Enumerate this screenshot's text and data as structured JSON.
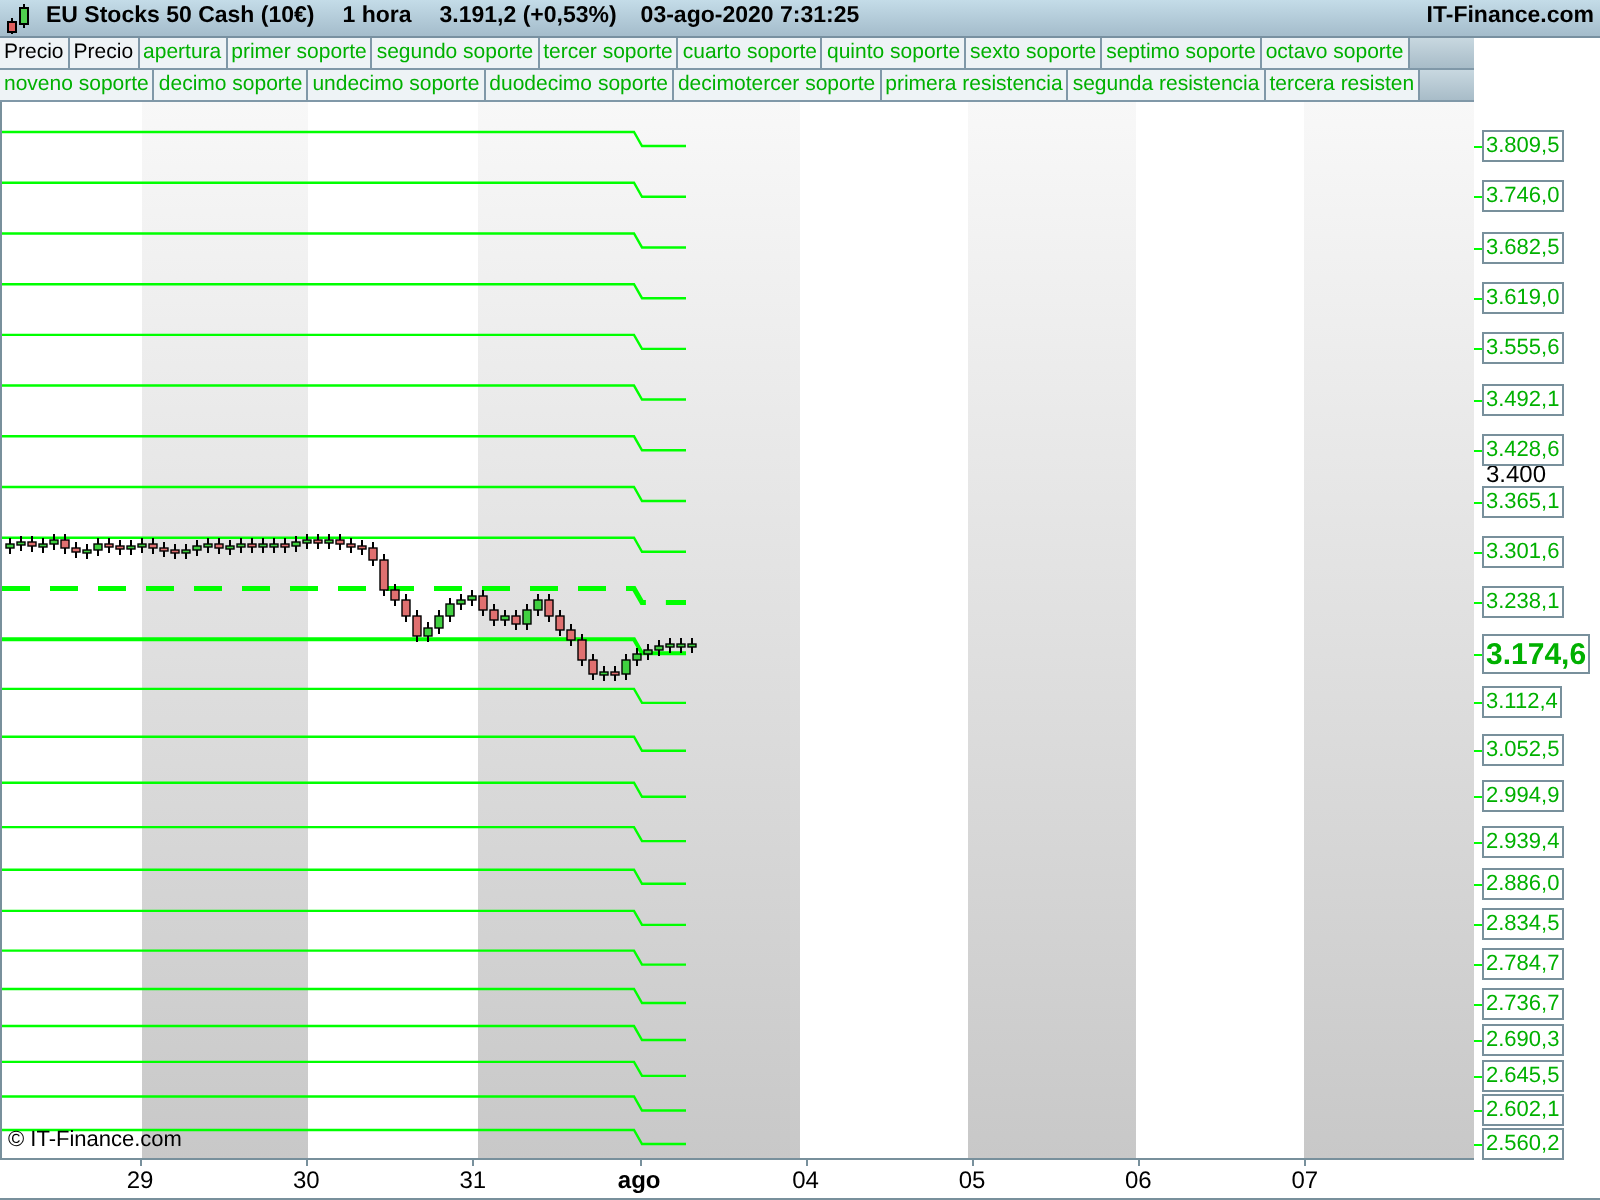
{
  "header": {
    "instrument": "EU Stocks 50 Cash (10€)",
    "timeframe": "1 hora",
    "quote": "3.191,2 (+0,53%)",
    "datetime": "03-ago-2020 7:31:25",
    "brand": "IT-Finance.com"
  },
  "legend_rows": [
    [
      {
        "label": "Precio",
        "color": "#000000"
      },
      {
        "label": "Precio",
        "color": "#000000"
      },
      {
        "label": "apertura",
        "color": "#00b000"
      },
      {
        "label": "primer soporte",
        "color": "#00b000"
      },
      {
        "label": "segundo soporte",
        "color": "#00b000"
      },
      {
        "label": "tercer soporte",
        "color": "#00b000"
      },
      {
        "label": "cuarto soporte",
        "color": "#00b000"
      },
      {
        "label": "quinto soporte",
        "color": "#00b000"
      },
      {
        "label": "sexto soporte",
        "color": "#00b000"
      },
      {
        "label": "septimo soporte",
        "color": "#00b000"
      },
      {
        "label": "octavo soporte",
        "color": "#00b000"
      }
    ],
    [
      {
        "label": "noveno soporte",
        "color": "#00b000"
      },
      {
        "label": "decimo soporte",
        "color": "#00b000"
      },
      {
        "label": "undecimo soporte",
        "color": "#00b000"
      },
      {
        "label": "duodecimo soporte",
        "color": "#00b000"
      },
      {
        "label": "decimotercer soporte",
        "color": "#00b000"
      },
      {
        "label": "primera resistencia",
        "color": "#00b000"
      },
      {
        "label": "segunda resistencia",
        "color": "#00b000"
      },
      {
        "label": "tercera resisten",
        "color": "#00b000"
      }
    ]
  ],
  "price_levels": [
    {
      "label": "3.809,5",
      "kind": "level",
      "dashed": false
    },
    {
      "label": "3.746,0",
      "kind": "level",
      "dashed": false
    },
    {
      "label": "3.682,5",
      "kind": "level",
      "dashed": false
    },
    {
      "label": "3.619,0",
      "kind": "level",
      "dashed": false
    },
    {
      "label": "3.555,6",
      "kind": "level",
      "dashed": false
    },
    {
      "label": "3.492,1",
      "kind": "level",
      "dashed": false
    },
    {
      "label": "3.428,6",
      "kind": "level",
      "dashed": false
    },
    {
      "label": "3.365,1",
      "kind": "level",
      "dashed": false
    },
    {
      "label": "3.301,6",
      "kind": "level",
      "dashed": false
    },
    {
      "label": "3.238,1",
      "kind": "level",
      "dashed": true
    },
    {
      "label": "3.174,6",
      "kind": "current",
      "dashed": false
    },
    {
      "label": "3.112,4",
      "kind": "level",
      "dashed": false
    },
    {
      "label": "3.052,5",
      "kind": "level",
      "dashed": false
    },
    {
      "label": "2.994,9",
      "kind": "level",
      "dashed": false
    },
    {
      "label": "2.939,4",
      "kind": "level",
      "dashed": false
    },
    {
      "label": "2.886,0",
      "kind": "level",
      "dashed": false
    },
    {
      "label": "2.834,5",
      "kind": "level",
      "dashed": false
    },
    {
      "label": "2.784,7",
      "kind": "level",
      "dashed": false
    },
    {
      "label": "2.736,7",
      "kind": "level",
      "dashed": false
    },
    {
      "label": "2.690,3",
      "kind": "level",
      "dashed": false
    },
    {
      "label": "2.645,5",
      "kind": "level",
      "dashed": false
    },
    {
      "label": "2.602,1",
      "kind": "level",
      "dashed": false
    },
    {
      "label": "2.560,2",
      "kind": "level",
      "dashed": false
    }
  ],
  "y_axis_ticks": [
    "3.400"
  ],
  "x_axis": [
    {
      "label": "29",
      "kind": "day"
    },
    {
      "label": "30",
      "kind": "day"
    },
    {
      "label": "31",
      "kind": "day"
    },
    {
      "label": "ago",
      "kind": "month"
    },
    {
      "label": "04",
      "kind": "day"
    },
    {
      "label": "05",
      "kind": "day"
    },
    {
      "label": "06",
      "kind": "day"
    },
    {
      "label": "07",
      "kind": "day"
    }
  ],
  "copyright": "© IT-Finance.com"
}
